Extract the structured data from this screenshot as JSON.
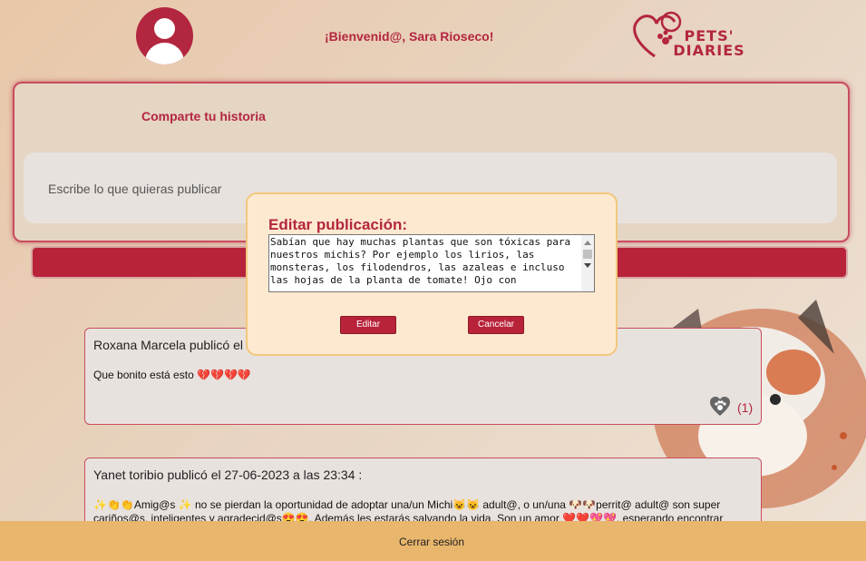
{
  "header": {
    "welcome": "¡Bienvenid@, Sara Rioseco!",
    "logo_text": "PETS' DIARIES"
  },
  "share": {
    "title": "Comparte tu historia",
    "placeholder": "Escribe lo que quieras publicar"
  },
  "posts": [
    {
      "author_line": "Roxana Marcela publicó el",
      "text": "Que bonito está esto 💔💔💔💔",
      "likes": "(1)"
    },
    {
      "author_line": "Yanet toribio publicó el 27-06-2023 a las 23:34 :",
      "text": "✨👏👏Amig@s ✨ no se pierdan la oportunidad de adoptar una/un Michi😺😺 adult@, o un/una 🐶🐶perrit@ adult@ son super cariños@s, inteligentes y agradecid@s😍😍. Además les estarás salvando la vida. Son un amor ❤️❤️💖💖, esperando encontrar una"
    }
  ],
  "modal": {
    "title": "Editar publicación:",
    "textarea_value": "Sabían que hay muchas plantas que son tóxicas para nuestros michis? Por ejemplo los lirios, las monsteras, los filodendros, las azaleas e incluso las hojas de la planta de tomate! Ojo con",
    "edit_label": "Editar",
    "cancel_label": "Cancelar"
  },
  "footer": {
    "logout_label": "Cerrar sesión"
  },
  "colors": {
    "brand": "#b3263f",
    "footer": "#e8b66c",
    "modal_bg": "#fde9cf"
  }
}
